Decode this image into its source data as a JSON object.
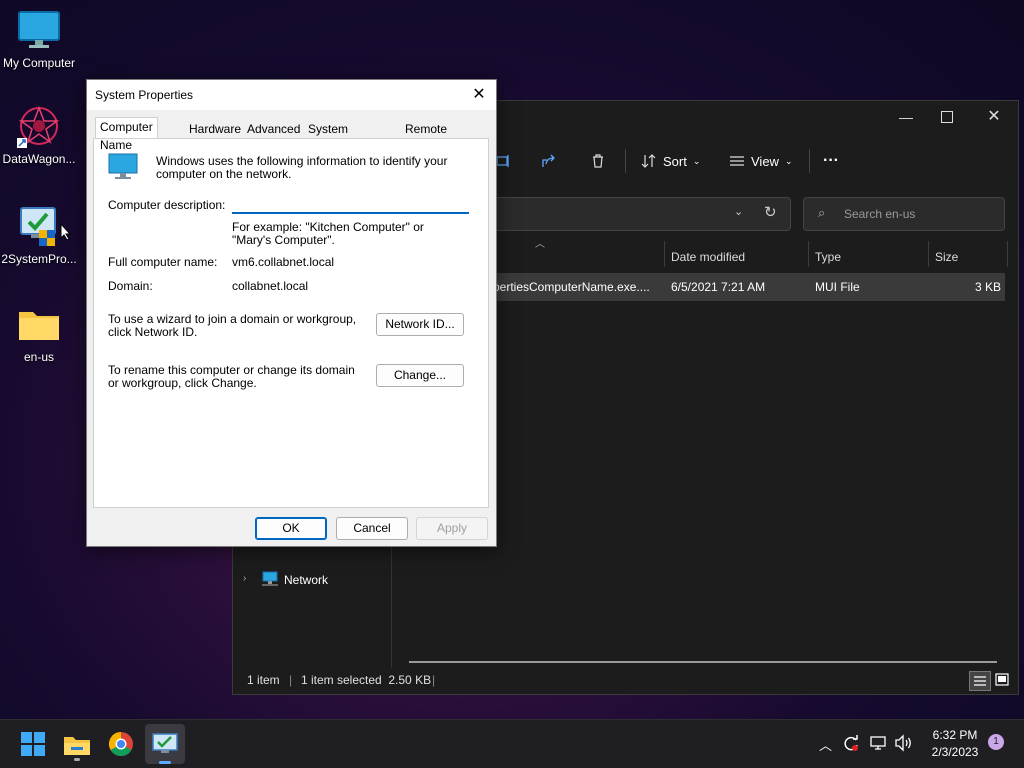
{
  "desktop": {
    "icons": [
      {
        "label": "My Computer"
      },
      {
        "label": "DataWagon..."
      },
      {
        "label": "2SystemPro..."
      },
      {
        "label": "en-us"
      }
    ]
  },
  "explorer": {
    "toolbar": {
      "sort_label": "Sort",
      "view_label": "View",
      "more_label": "···"
    },
    "search": {
      "placeholder": "Search en-us"
    },
    "columns": [
      "Date modified",
      "Type",
      "Size"
    ],
    "file": {
      "name": "pertiesComputerName.exe....",
      "date": "6/5/2021 7:21 AM",
      "type": "MUI File",
      "size": "3 KB"
    },
    "nav": {
      "network_label": "Network"
    },
    "status": {
      "count": "1 item",
      "selected": "1 item selected  2.50 KB"
    }
  },
  "dialog": {
    "title": "System Properties",
    "tabs": [
      "Computer Name",
      "Hardware",
      "Advanced",
      "System Protection",
      "Remote"
    ],
    "intro": "Windows uses the following information to identify your computer on the network.",
    "description_label": "Computer description:",
    "description_value": "",
    "example": "For example: \"Kitchen Computer\" or \"Mary's Computer\".",
    "full_name_label": "Full computer name:",
    "full_name_value": "vm6.collabnet.local",
    "domain_label": "Domain:",
    "domain_value": "collabnet.local",
    "network_id_text": "To use a wizard to join a domain or workgroup, click Network ID.",
    "network_id_button": "Network ID...",
    "change_text": "To rename this computer or change its domain or workgroup, click Change.",
    "change_button": "Change...",
    "ok": "OK",
    "cancel": "Cancel",
    "apply": "Apply"
  },
  "taskbar": {
    "time": "6:32 PM",
    "date": "2/3/2023",
    "notification_count": "1"
  },
  "colors": {
    "accent": "#0067c0",
    "explorer_bg": "#1c1c1c",
    "taskbar_bg": "#1f1f23"
  }
}
